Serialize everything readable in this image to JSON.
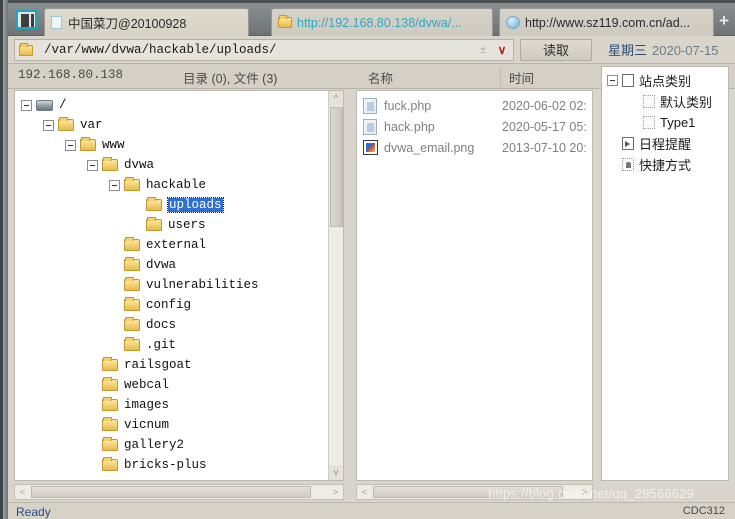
{
  "window": {
    "app_icon": "app-window-icon"
  },
  "tabs": [
    {
      "label": "中国菜刀@20100928",
      "icon": "page-icon",
      "active": true
    },
    {
      "label": "http://192.168.80.138/dvwa/...",
      "icon": "folder-icon",
      "active": false
    },
    {
      "label": "http://www.sz119.com.cn/ad...",
      "icon": "globe-icon",
      "active": false
    }
  ],
  "tab_add_label": "+",
  "addressbar": {
    "icon": "folder-icon",
    "path": "/var/www/dvwa/hackable/uploads/",
    "updown_glyph": "±",
    "dropdown_glyph": "∨",
    "read_button": "读取"
  },
  "clock": {
    "weekday": "星期三",
    "date": "2020-07-15"
  },
  "columns": {
    "ip": "192.168.80.138",
    "counts": "目录 (0), 文件 (3)",
    "name": "名称",
    "time": "时间"
  },
  "tree": [
    {
      "indent": 0,
      "toggle": "minus",
      "icon": "disk-icon",
      "label": "/",
      "selected": false
    },
    {
      "indent": 1,
      "toggle": "minus",
      "icon": "folder-icon",
      "label": "var",
      "selected": false
    },
    {
      "indent": 2,
      "toggle": "minus",
      "icon": "folder-icon",
      "label": "www",
      "selected": false
    },
    {
      "indent": 3,
      "toggle": "minus",
      "icon": "folder-icon",
      "label": "dvwa",
      "selected": false
    },
    {
      "indent": 4,
      "toggle": "minus",
      "icon": "folder-icon",
      "label": "hackable",
      "selected": false
    },
    {
      "indent": 5,
      "toggle": "none",
      "icon": "folder-icon",
      "label": "uploads",
      "selected": true
    },
    {
      "indent": 5,
      "toggle": "none",
      "icon": "folder-icon",
      "label": "users",
      "selected": false
    },
    {
      "indent": 4,
      "toggle": "none",
      "icon": "folder-icon",
      "label": "external",
      "selected": false
    },
    {
      "indent": 4,
      "toggle": "none",
      "icon": "folder-icon",
      "label": "dvwa",
      "selected": false
    },
    {
      "indent": 4,
      "toggle": "none",
      "icon": "folder-icon",
      "label": "vulnerabilities",
      "selected": false
    },
    {
      "indent": 4,
      "toggle": "none",
      "icon": "folder-icon",
      "label": "config",
      "selected": false
    },
    {
      "indent": 4,
      "toggle": "none",
      "icon": "folder-icon",
      "label": "docs",
      "selected": false
    },
    {
      "indent": 4,
      "toggle": "none",
      "icon": "folder-icon",
      "label": ".git",
      "selected": false
    },
    {
      "indent": 3,
      "toggle": "none",
      "icon": "folder-icon",
      "label": "railsgoat",
      "selected": false
    },
    {
      "indent": 3,
      "toggle": "none",
      "icon": "folder-icon",
      "label": "webcal",
      "selected": false
    },
    {
      "indent": 3,
      "toggle": "none",
      "icon": "folder-icon",
      "label": "images",
      "selected": false
    },
    {
      "indent": 3,
      "toggle": "none",
      "icon": "folder-icon",
      "label": "vicnum",
      "selected": false
    },
    {
      "indent": 3,
      "toggle": "none",
      "icon": "folder-icon",
      "label": "gallery2",
      "selected": false
    },
    {
      "indent": 3,
      "toggle": "none",
      "icon": "folder-icon",
      "label": "bricks-plus",
      "selected": false
    }
  ],
  "files": [
    {
      "icon": "php-file-icon",
      "name": "fuck.php",
      "time": "2020-06-02 02:"
    },
    {
      "icon": "php-file-icon",
      "name": "hack.php",
      "time": "2020-05-17 05:"
    },
    {
      "icon": "image-file-icon",
      "name": "dvwa_email.png",
      "time": "2013-07-10 20:"
    }
  ],
  "sidepanel": [
    {
      "indent": 0,
      "toggle": "minus",
      "icon": "site-category-icon",
      "label": "站点类别"
    },
    {
      "indent": 1,
      "toggle": "none",
      "icon": "page-icon",
      "label": "默认类别"
    },
    {
      "indent": 1,
      "toggle": "none",
      "icon": "page-icon",
      "label": "Type1"
    },
    {
      "indent": 0,
      "toggle": "none",
      "icon": "schedule-icon",
      "label": "日程提醒"
    },
    {
      "indent": 0,
      "toggle": "none",
      "icon": "shortcut-icon",
      "label": "快捷方式"
    }
  ],
  "statusbar": {
    "left": "Ready",
    "right": "CDC312"
  },
  "watermark": "https://blog.csdn.net/qq_29566629",
  "colors": {
    "accent_cyan": "#16a8c4",
    "link": "#2fa8c2",
    "selection": "#2f6fd0",
    "chrome": "#d9d5cb",
    "titlebar": "#7c8183"
  }
}
